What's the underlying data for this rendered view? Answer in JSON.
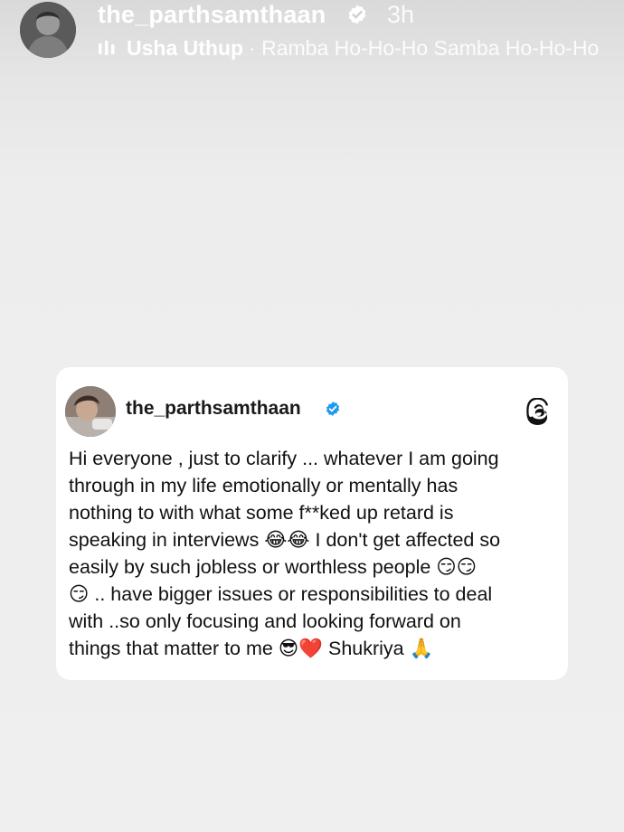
{
  "story": {
    "username": "the_parthsamthaan",
    "time": "3h",
    "music": {
      "artist": "Usha Uthup",
      "song": "· Ramba Ho-Ho-Ho Samba Ho-Ho-Ho"
    },
    "icons": {
      "avatar": "profile-avatar",
      "verified": "verified-badge-icon",
      "music": "audio-bars-icon"
    }
  },
  "card": {
    "username": "the_parthsamthaan",
    "text": "Hi everyone , just to clarify ... whatever I am going\nthrough in my life emotionally or mentally has\nnothing to with what some f**ked up retard is\nspeaking in interviews 😂😂 I don't get affected so\neasily by such jobless or worthless people 😏😏\n😏 .. have bigger issues or responsibilities to deal\nwith ..so only focusing and looking forward on\nthings that matter to me 😎❤️ Shukriya 🙏",
    "icons": {
      "verified": "verified-badge-icon",
      "app": "threads-logo-icon"
    }
  },
  "colors": {
    "verified_blue": "#1d9bf0",
    "card_background": "#ffffff",
    "page_background": "#efefef"
  }
}
